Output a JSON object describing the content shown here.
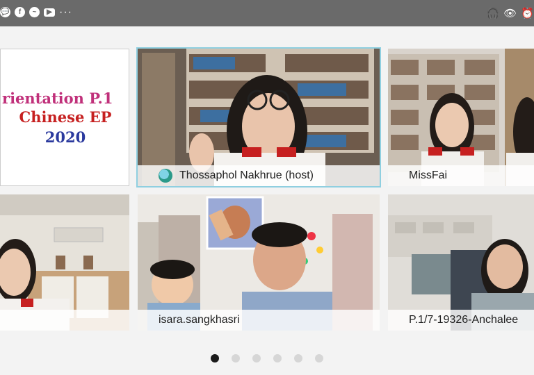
{
  "status_bar": {
    "left_icons": [
      "chat-icon",
      "facebook-icon",
      "messenger-icon",
      "youtube-icon"
    ],
    "more": "···",
    "right_icons": [
      "headset-icon",
      "eye-icon",
      "alarm-icon"
    ]
  },
  "slide": {
    "line1": "rientation P.1",
    "line2": "Chinese EP",
    "line3": "2020",
    "line1_color": "#c0307a",
    "line2_color": "#c62020",
    "line3_color": "#2b3a9e"
  },
  "participants": [
    {
      "name": "Thossaphol Nakhrue (host)",
      "host": true
    },
    {
      "name": "MissFai"
    },
    {
      "name": ""
    },
    {
      "name": "isara.sangkhasri"
    },
    {
      "name": "P.1/7-19326-Anchalee"
    }
  ],
  "pager": {
    "count": 6,
    "active": 1
  },
  "colors": {
    "accent": "#8fcfe0",
    "statusbar": "#6a6a6a"
  }
}
